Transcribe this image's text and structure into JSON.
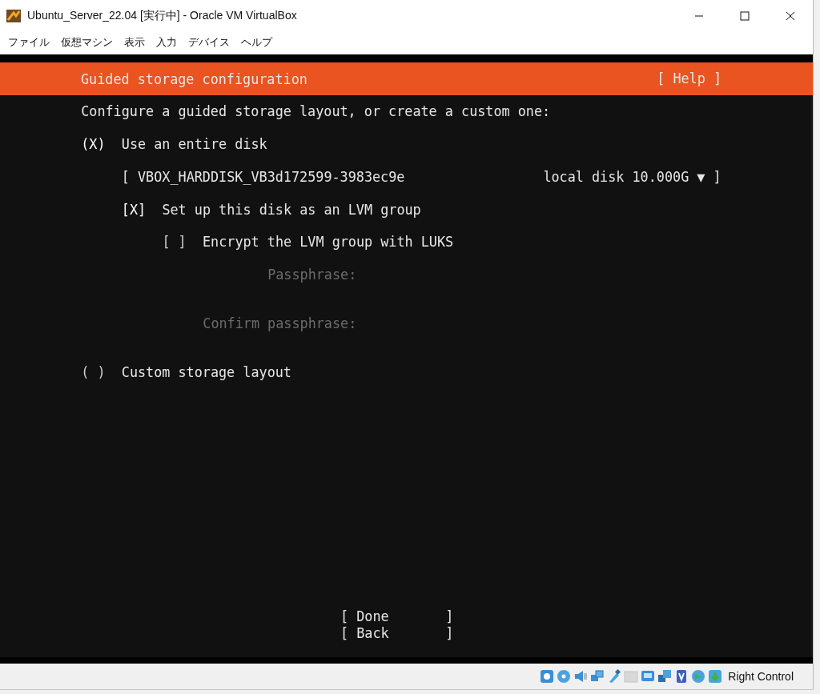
{
  "window": {
    "title": "Ubuntu_Server_22.04 [実行中] - Oracle VM VirtualBox"
  },
  "menu": [
    "ファイル",
    "仮想マシン",
    "表示",
    "入力",
    "デバイス",
    "ヘルプ"
  ],
  "header": {
    "title": "Guided storage configuration",
    "help": "[ Help ]"
  },
  "intro": "Configure a guided storage layout, or create a custom one:",
  "entire_disk": {
    "mark": "(X)",
    "label": "Use an entire disk",
    "selected": true
  },
  "disk": {
    "left": "[",
    "name": "VBOX_HARDDISK_VB3d172599-3983ec9e",
    "size": "local disk 10.000G",
    "arrow": "▼",
    "right": "]"
  },
  "lvm": {
    "mark": "[X]",
    "label": "Set up this disk as an LVM group",
    "checked": true
  },
  "encrypt": {
    "mark": "[ ]",
    "label": "Encrypt the LVM group with LUKS",
    "checked": false
  },
  "passphrase_fields": [
    {
      "label": "Passphrase:",
      "disabled": true
    },
    {
      "label": "Confirm passphrase:",
      "disabled": true
    }
  ],
  "custom_layout": {
    "mark": "( )",
    "label": "Custom storage layout",
    "selected": false
  },
  "buttons": [
    {
      "label": "[ Done       ]"
    },
    {
      "label": "[ Back       ]"
    }
  ],
  "status_bar": {
    "host_key": "Right Control"
  }
}
